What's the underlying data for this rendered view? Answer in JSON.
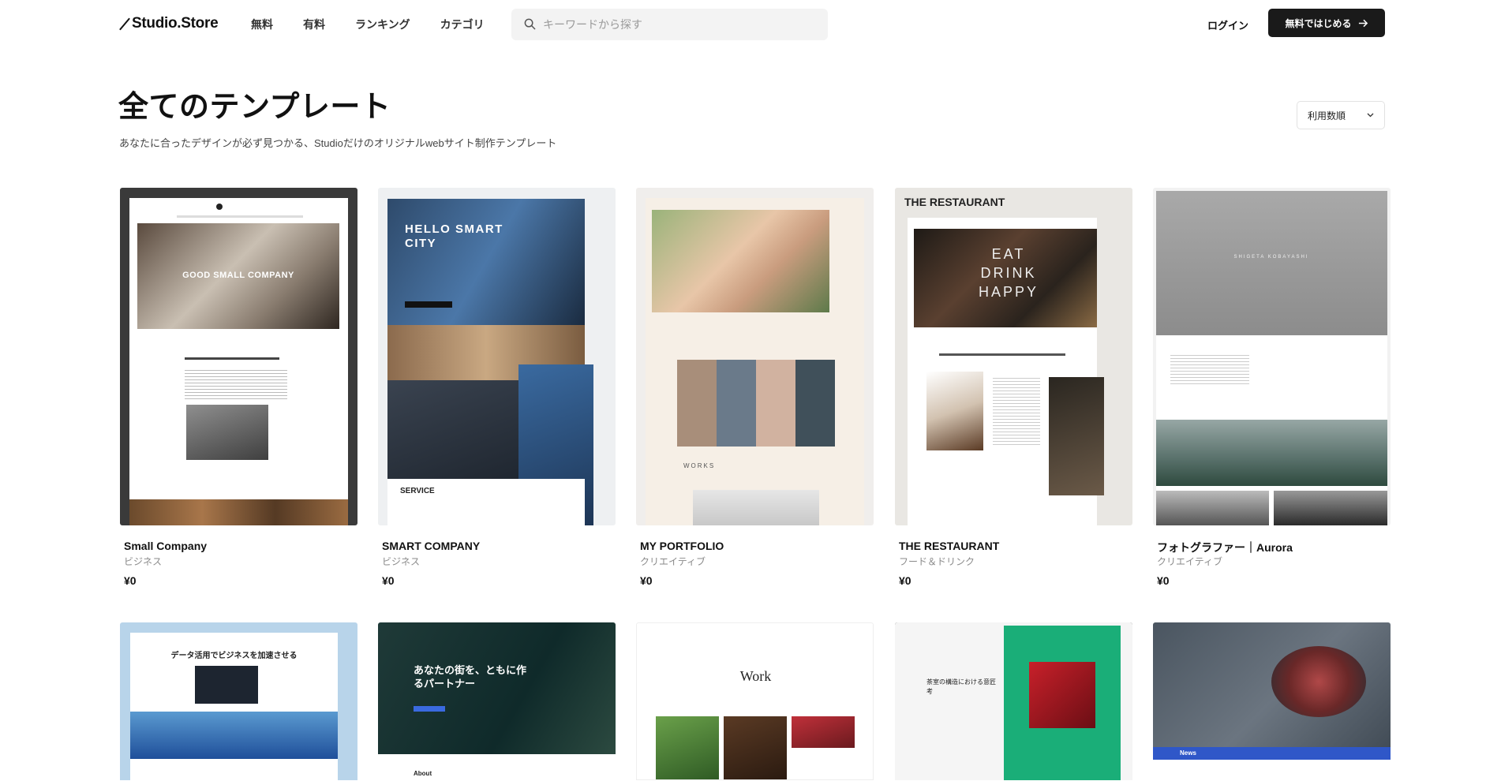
{
  "header": {
    "logo": "Studio.Store",
    "nav": [
      "無料",
      "有料",
      "ランキング",
      "カテゴリ"
    ],
    "search_placeholder": "キーワードから探す",
    "login": "ログイン",
    "cta": "無料ではじめる"
  },
  "page": {
    "title": "全てのテンプレート",
    "subtitle": "あなたに合ったデザインが必ず見つかる、Studioだけのオリジナルwebサイト制作テンプレート",
    "sort": "利用数順"
  },
  "templates": [
    {
      "title": "Small Company",
      "category": "ビジネス",
      "price": "¥0",
      "preview_text": "GOOD SMALL COMPANY"
    },
    {
      "title": "SMART COMPANY",
      "category": "ビジネス",
      "price": "¥0",
      "preview_text": "HELLO SMART CITY"
    },
    {
      "title": "MY PORTFOLIO",
      "category": "クリエイティブ",
      "price": "¥0",
      "preview_text": "WORKS"
    },
    {
      "title": "THE RESTAURANT",
      "category": "フード＆ドリンク",
      "price": "¥0",
      "preview_text": "EAT DRINK HAPPY"
    },
    {
      "title": "フォトグラファー｜Aurora",
      "category": "クリエイティブ",
      "price": "¥0",
      "preview_text": "SHIGETA KOBAYASHI"
    },
    {
      "title": "",
      "category": "",
      "price": "",
      "preview_text": "データ活用でビジネスを加速させる"
    },
    {
      "title": "",
      "category": "",
      "price": "",
      "preview_text": "あなたの街を、ともに作るパートナー"
    },
    {
      "title": "",
      "category": "",
      "price": "",
      "preview_text": "Work"
    },
    {
      "title": "",
      "category": "",
      "price": "",
      "preview_text": "茶室の構造における意匠考"
    },
    {
      "title": "",
      "category": "",
      "price": "",
      "preview_text": "News"
    }
  ],
  "colors": {
    "accent": "#1a1a1a",
    "search_bg": "#f3f3f3"
  },
  "icons": {
    "search": "search-icon",
    "arrow": "arrow-right-icon",
    "chevron": "chevron-down-icon"
  }
}
